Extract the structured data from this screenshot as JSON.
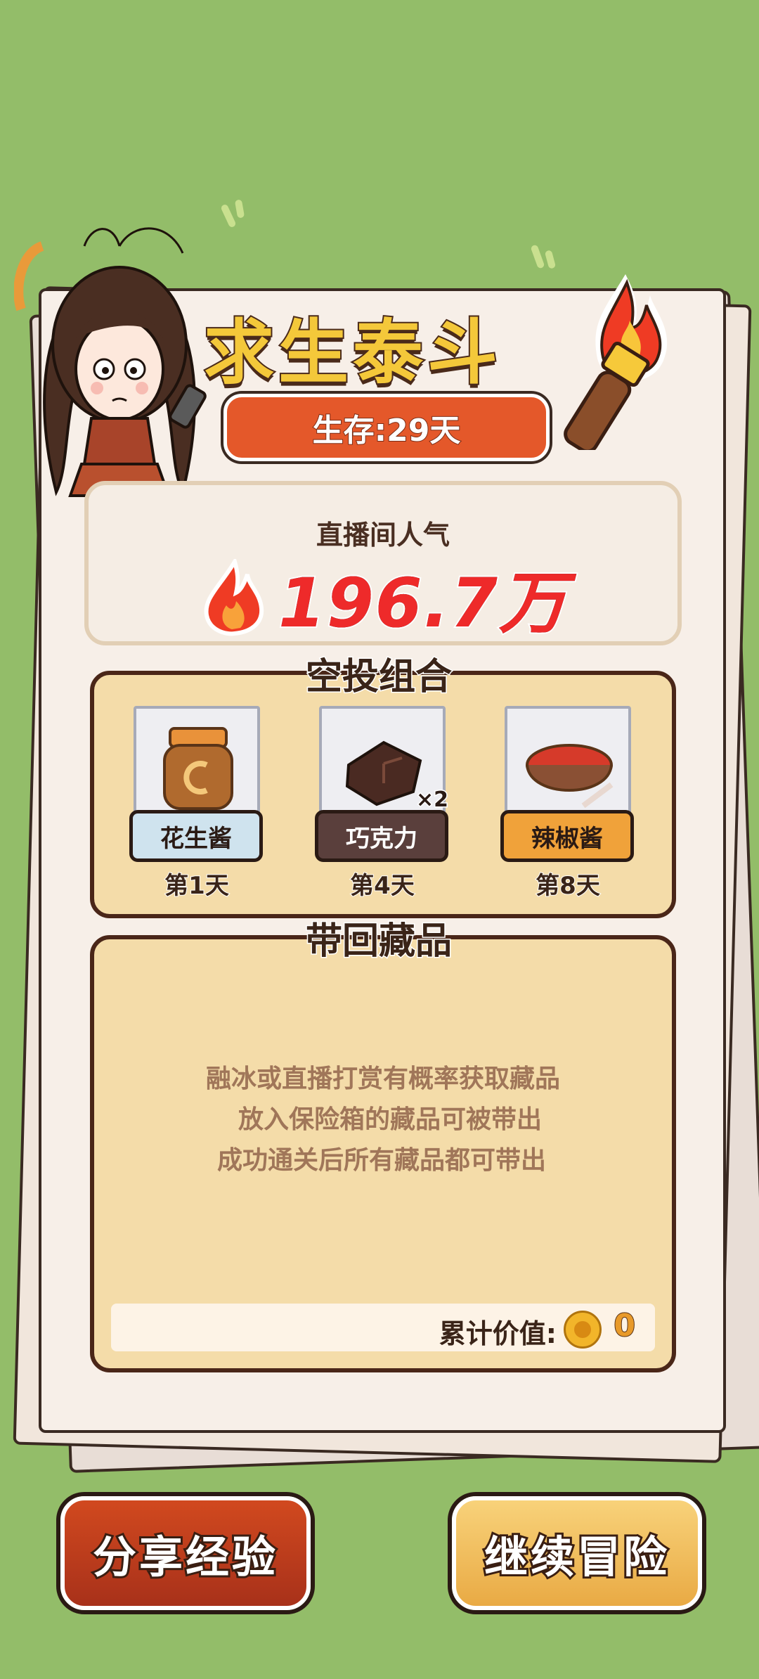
{
  "title": "求生泰斗",
  "survival": "生存:29天",
  "popularity": {
    "label": "直播间人气",
    "value": "196.7万"
  },
  "airdrop": {
    "title": "空投组合",
    "items": [
      {
        "name": "花生酱",
        "day": "第1天",
        "label_color": "#cfe3ee",
        "label_text_color": "#2a1a14",
        "count": ""
      },
      {
        "name": "巧克力",
        "day": "第4天",
        "label_color": "#5a3f3c",
        "label_text_color": "#ffffff",
        "count": "×2"
      },
      {
        "name": "辣椒酱",
        "day": "第8天",
        "label_color": "#f0a23a",
        "label_text_color": "#2a1a14",
        "count": ""
      }
    ]
  },
  "collection": {
    "title": "带回藏品",
    "notes": [
      "融冰或直播打赏有概率获取藏品",
      "放入保险箱的藏品可被带出",
      "成功通关后所有藏品都可带出"
    ],
    "value_label": "累计价值:",
    "value": "0"
  },
  "buttons": {
    "share": "分享经验",
    "continue": "继续冒险"
  },
  "colors": {
    "background": "#93bd69",
    "accent_red": "#ee2a2a",
    "panel": "#f4dca9",
    "outline": "#4a2618"
  }
}
